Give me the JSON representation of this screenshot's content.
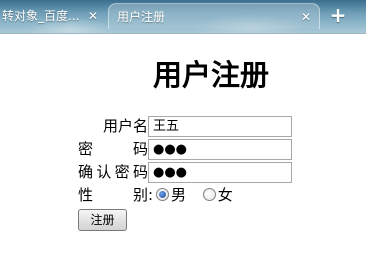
{
  "tabs": [
    {
      "label": "转对象_百度...",
      "close_icon": "close-icon"
    },
    {
      "label": "用户注册",
      "close_icon": "close-icon",
      "active": true
    }
  ],
  "new_tab": {
    "label": "+"
  },
  "page": {
    "title": "用户注册"
  },
  "form": {
    "username": {
      "label": "用户名",
      "colon": ":",
      "value": "王五"
    },
    "password": {
      "label": "密码",
      "colon": ":",
      "value": "●●●"
    },
    "confirm": {
      "label": "确认密码",
      "colon": ":",
      "value": "●●●"
    },
    "gender": {
      "label": "性别",
      "colon": ":",
      "options": [
        {
          "label": "男",
          "checked": true
        },
        {
          "label": "女",
          "checked": false
        }
      ]
    },
    "submit_label": "注册"
  },
  "colors": {
    "tabbar": "#5f93ae",
    "radio_checked": "#1f4f9c"
  }
}
